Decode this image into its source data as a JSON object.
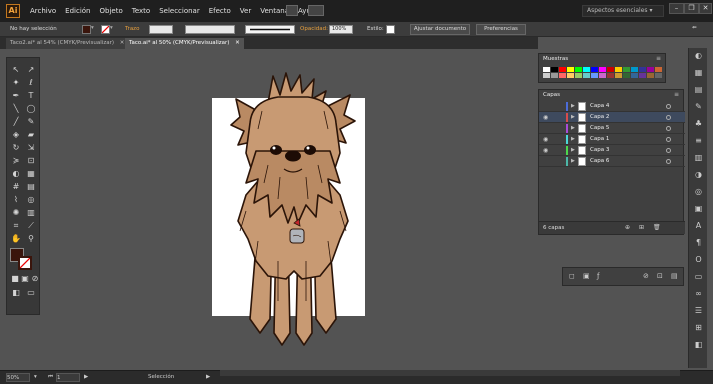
{
  "app": {
    "logo": "Ai"
  },
  "menu": [
    "Archivo",
    "Edición",
    "Objeto",
    "Texto",
    "Seleccionar",
    "Efecto",
    "Ver",
    "Ventana",
    "Ayuda"
  ],
  "workspace": {
    "label": "Aspectos esenciales"
  },
  "window_controls": {
    "minimize": "–",
    "restore": "❐",
    "close": "✕"
  },
  "control_bar": {
    "selection_text": "No hay selección",
    "stroke_label": "Trazo",
    "opacity_label": "Opacidad:",
    "opacity_value": "100%",
    "style_label": "Estilo:",
    "doc_setup_button": "Ajustar documento",
    "prefs_button": "Preferencias"
  },
  "tabs": [
    {
      "label": "Taco2.ai* al 54% (CMYK/Previsualizar)",
      "close": "✕"
    },
    {
      "label": "Taco.ai* al 50% (CMYK/Previsualizar)",
      "close": "✕"
    }
  ],
  "panels": {
    "swatches_title": "Muestras",
    "layers_title": "Capas",
    "layers_count": "6 capas",
    "layers": [
      {
        "name": "Capa 4",
        "color": "#4c6cd8",
        "visible": false
      },
      {
        "name": "Capa 2",
        "color": "#d84c4c",
        "visible": true,
        "selected": true
      },
      {
        "name": "Capa 5",
        "color": "#a84cd8",
        "visible": false
      },
      {
        "name": "Capa 1",
        "color": "#4cd8d8",
        "visible": true
      },
      {
        "name": "Capa 3",
        "color": "#4cd84c",
        "visible": true
      },
      {
        "name": "Capa 6",
        "color": "#4cb8a8",
        "visible": false
      }
    ],
    "swatches_row1": [
      "#ffffff",
      "#000000",
      "#ff0000",
      "#ffff00",
      "#00ff00",
      "#00ffff",
      "#0000ff",
      "#ff00ff",
      "#cc0000",
      "#ffcc00",
      "#339933",
      "#0099cc",
      "#333399",
      "#990099",
      "#cc6633"
    ],
    "swatches_row2": [
      "#cccccc",
      "#999999",
      "#ff6666",
      "#ffcc66",
      "#99cc66",
      "#66cccc",
      "#6699ff",
      "#cc66cc",
      "#993333",
      "#cc9933",
      "#336633",
      "#336699",
      "#663399",
      "#996633",
      "#666666"
    ]
  },
  "status": {
    "zoom": "50%",
    "page": "1",
    "tool": "Selección"
  },
  "colors": {
    "accent": "#e8a03c",
    "fill": "#3a150c",
    "dog": "#c89a73"
  }
}
